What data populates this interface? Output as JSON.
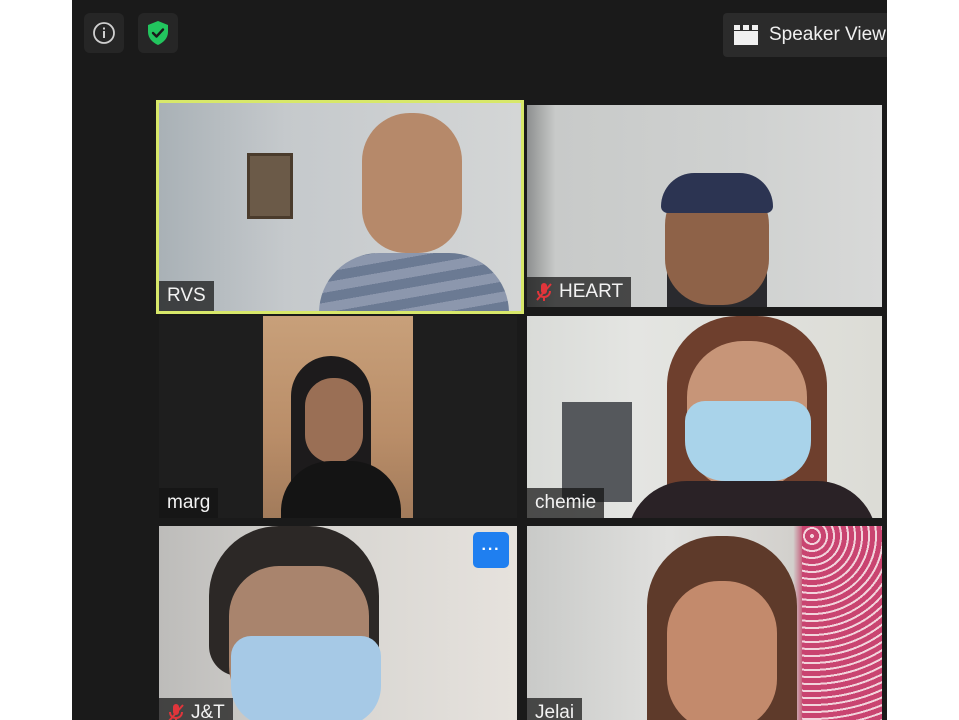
{
  "toolbar": {
    "info_icon": "info-icon",
    "security_icon": "shield-check-icon",
    "speaker_view_label": "Speaker View",
    "speaker_view_icon": "grid-view-icon"
  },
  "participants": [
    {
      "name": "RVS",
      "muted": false,
      "active_speaker": true
    },
    {
      "name": "HEART",
      "muted": true,
      "active_speaker": false
    },
    {
      "name": "marg",
      "muted": false,
      "active_speaker": false
    },
    {
      "name": "chemie",
      "muted": false,
      "active_speaker": false
    },
    {
      "name": "J&T",
      "muted": true,
      "active_speaker": false,
      "more_options_label": "···"
    },
    {
      "name": "Jelai",
      "muted": false,
      "active_speaker": false
    }
  ],
  "colors": {
    "active_border": "#d8e86a",
    "more_button": "#1f7ff0",
    "muted_icon": "#e0353b",
    "security_green": "#22c55e"
  }
}
